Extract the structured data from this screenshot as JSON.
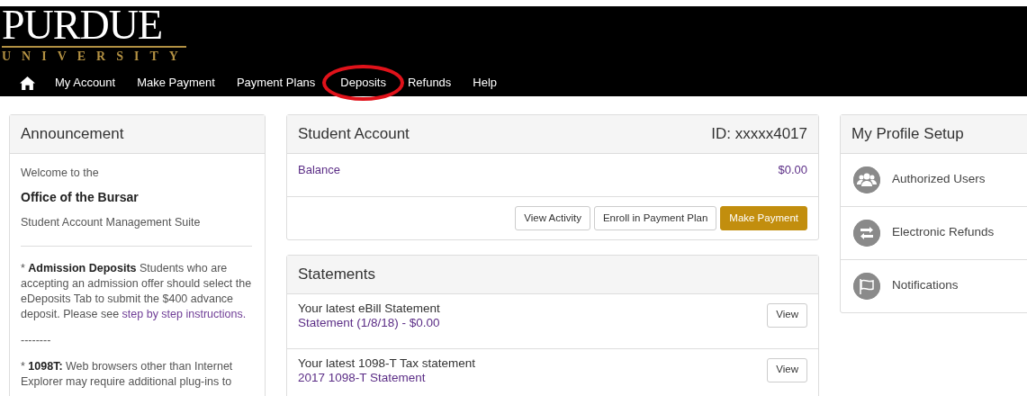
{
  "logo": {
    "name": "PURDUE",
    "subtitle": "UNIVERSITY"
  },
  "nav": [
    {
      "label": "My Account",
      "highlighted": false
    },
    {
      "label": "Make Payment",
      "highlighted": false
    },
    {
      "label": "Payment Plans",
      "highlighted": false
    },
    {
      "label": "Deposits",
      "highlighted": true
    },
    {
      "label": "Refunds",
      "highlighted": false
    },
    {
      "label": "Help",
      "highlighted": false
    }
  ],
  "announcement": {
    "title": "Announcement",
    "welcome": "Welcome to the",
    "office": "Office of the Bursar",
    "suite": "Student Account Management Suite",
    "items": [
      {
        "text": "* **Admission Deposits** Students who are accepting an admission offer should select the eDeposits Tab to submit the $400 advance deposit. Please see",
        "link": "step by step instructions."
      },
      {
        "text": "--------"
      },
      {
        "text": "* **1098T:** Web browsers other than Internet Explorer may require additional plug-ins to"
      }
    ]
  },
  "student_account": {
    "title": "Student Account",
    "id": "ID: xxxxx4017",
    "balance_label": "Balance",
    "balance": "$0.00",
    "buttons": [
      {
        "label": "View Activity",
        "kind": "default"
      },
      {
        "label": "Enroll in Payment Plan",
        "kind": "default"
      },
      {
        "label": "Make Payment",
        "kind": "primary"
      }
    ]
  },
  "statements": {
    "title": "Statements",
    "rows": [
      {
        "caption": "Your latest eBill Statement",
        "link": "Statement (1/8/18) - $0.00",
        "button": "View"
      },
      {
        "caption": "Your latest 1098-T Tax statement",
        "link": "2017 1098-T Statement",
        "button": "View"
      }
    ]
  },
  "profile": {
    "title": "My Profile Setup",
    "items": [
      {
        "label": "Authorized Users",
        "kind": "users"
      },
      {
        "label": "Electronic Refunds",
        "kind": "exchange"
      },
      {
        "label": "Notifications",
        "kind": "flag"
      }
    ]
  }
}
